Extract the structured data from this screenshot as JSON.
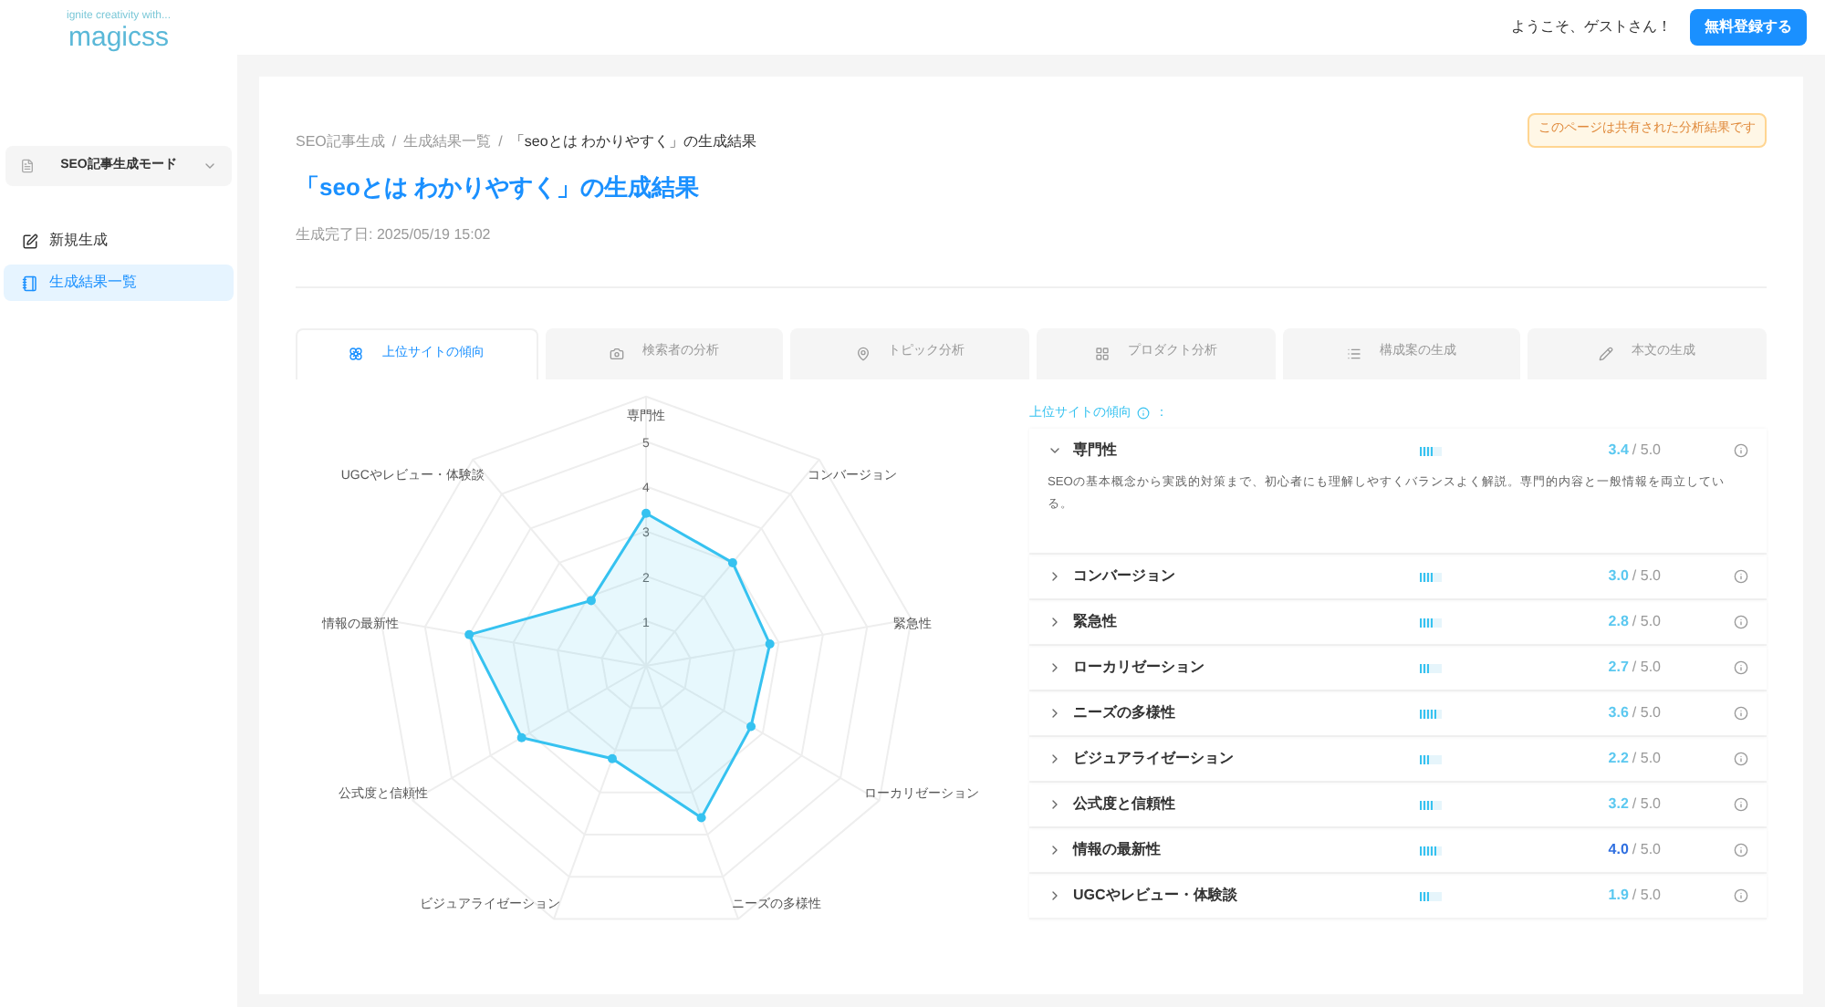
{
  "header": {
    "tagline": "ignite creativity with...",
    "logo": "magicss",
    "greeting": "ようこそ、ゲストさん！",
    "signup_button": "無料登録する"
  },
  "sidebar": {
    "mode_select": "SEO記事生成モード",
    "items": [
      {
        "label": "新規生成",
        "selected": false
      },
      {
        "label": "生成結果一覧",
        "selected": true
      }
    ]
  },
  "breadcrumb": [
    "SEO記事生成",
    "生成結果一覧",
    "「seoとは わかりやすく」の生成結果"
  ],
  "breadcrumb_separator": "/",
  "shared_notice": "このページは共有された分析結果です",
  "title": "「seoとは わかりやすく」の生成結果",
  "completed": "生成完了日: 2025/05/19 15:02",
  "tabs": [
    {
      "label": "上位サイトの傾向",
      "selected": true
    },
    {
      "label": "検索者の分析",
      "selected": false
    },
    {
      "label": "トピック分析",
      "selected": false
    },
    {
      "label": "プロダクト分析",
      "selected": false
    },
    {
      "label": "構成案の生成",
      "selected": false
    },
    {
      "label": "本文の生成",
      "selected": false
    }
  ],
  "radar_chart": {
    "ticks": [
      "5",
      "4",
      "3",
      "2",
      "1"
    ],
    "color": "#36c2f0",
    "axis_labels": [
      "専門性",
      "UGCやレビュー・体験談",
      "コンバージョン",
      "情報の最新性",
      "緊急性",
      "公式度と信頼性",
      "ローカリゼーション",
      "ビジュアライゼーション",
      "ニーズの多様性"
    ]
  },
  "scores": {
    "heading": "上位サイトの傾向",
    "heading_suffix": "：",
    "items": [
      {
        "name": "専門性",
        "score": "3.4",
        "max": "/ 5.0",
        "level": 0.68,
        "expanded": true,
        "description": "SEOの基本概念から実践的対策まで、初心者にも理解しやすくバランスよく解説。専門的内容と一般情報を両立している。"
      },
      {
        "name": "コンバージョン",
        "score": "3.0",
        "max": "/ 5.0",
        "level": 0.6,
        "expanded": false
      },
      {
        "name": "緊急性",
        "score": "2.8",
        "max": "/ 5.0",
        "level": 0.56,
        "expanded": false
      },
      {
        "name": "ローカリゼーション",
        "score": "2.7",
        "max": "/ 5.0",
        "level": 0.54,
        "expanded": false
      },
      {
        "name": "ニーズの多様性",
        "score": "3.6",
        "max": "/ 5.0",
        "level": 0.72,
        "expanded": false
      },
      {
        "name": "ビジュアライゼーション",
        "score": "2.2",
        "max": "/ 5.0",
        "level": 0.44,
        "expanded": false
      },
      {
        "name": "公式度と信頼性",
        "score": "3.2",
        "max": "/ 5.0",
        "level": 0.64,
        "expanded": false
      },
      {
        "name": "情報の最新性",
        "score": "4.0",
        "max": "/ 5.0",
        "level": 0.8,
        "expanded": false
      },
      {
        "name": "UGCやレビュー・体験談",
        "score": "1.9",
        "max": "/ 5.0",
        "level": 0.38,
        "expanded": false
      }
    ]
  }
}
